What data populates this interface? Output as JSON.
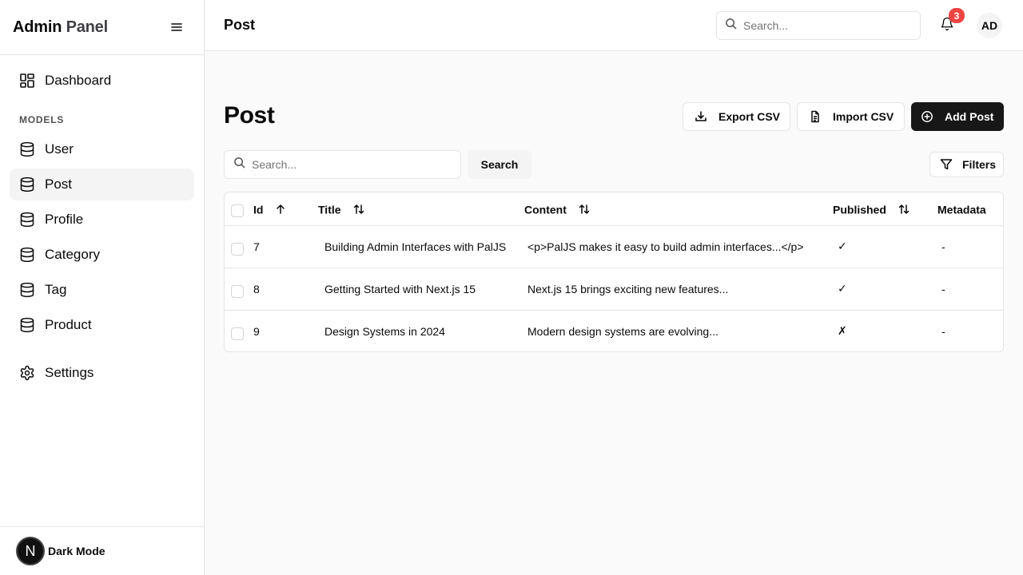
{
  "sidebar": {
    "brand_part1": "Admin ",
    "brand_part2": "Panel",
    "dashboard_label": "Dashboard",
    "section_label": "MODELS",
    "models": [
      {
        "label": "User",
        "icon": "database-icon"
      },
      {
        "label": "Post",
        "icon": "database-icon",
        "active": true
      },
      {
        "label": "Profile",
        "icon": "database-icon"
      },
      {
        "label": "Category",
        "icon": "database-icon"
      },
      {
        "label": "Tag",
        "icon": "database-icon"
      },
      {
        "label": "Product",
        "icon": "database-icon"
      }
    ],
    "settings_label": "Settings",
    "footer_badge": "N",
    "dark_mode_label": "Dark Mode"
  },
  "header": {
    "title": "Post",
    "search_placeholder": "Search...",
    "notification_count": "3",
    "avatar_initials": "AD"
  },
  "main": {
    "page_title": "Post",
    "export_label": "Export CSV",
    "import_label": "Import CSV",
    "add_label": "Add Post",
    "search_placeholder": "Search...",
    "search_button": "Search",
    "filters_label": "Filters"
  },
  "table": {
    "columns": [
      {
        "label": "Id",
        "sort": "asc"
      },
      {
        "label": "Title",
        "sort": "both"
      },
      {
        "label": "Content",
        "sort": "both"
      },
      {
        "label": "Published",
        "sort": "both"
      },
      {
        "label": "Metadata",
        "sort": "none"
      }
    ],
    "rows": [
      {
        "id": "7",
        "title": "Building Admin Interfaces with PalJS",
        "content": "<p>PalJS makes it easy to build admin interfaces...</p>",
        "published": "✓",
        "metadata": "-"
      },
      {
        "id": "8",
        "title": "Getting Started with Next.js 15",
        "content": "Next.js 15 brings exciting new features...",
        "published": "✓",
        "metadata": "-"
      },
      {
        "id": "9",
        "title": "Design Systems in 2024",
        "content": "Modern design systems are evolving...",
        "published": "✗",
        "metadata": "-"
      }
    ]
  },
  "colors": {
    "accent_dark": "#171717",
    "badge_red": "#ef4444",
    "active_bg": "#f4f4f5",
    "border": "#e5e5e5"
  }
}
